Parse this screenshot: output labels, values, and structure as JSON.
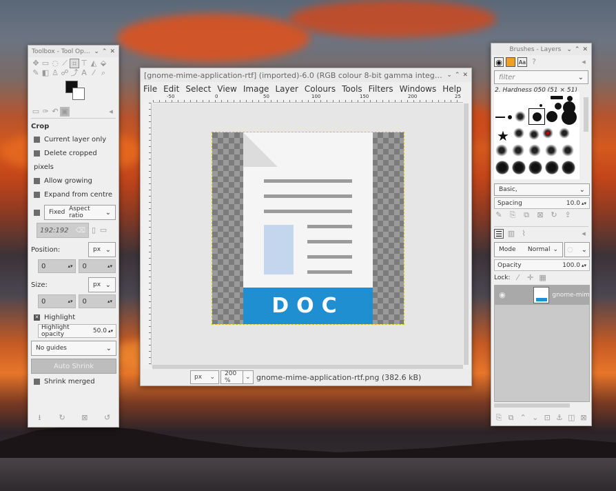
{
  "toolbox": {
    "title": "Toolbox - Tool Opti...",
    "tool_name": "Crop",
    "options": {
      "current_layer_only": "Current layer only",
      "delete_cropped_pixels": "Delete cropped pixels",
      "allow_growing": "Allow growing",
      "expand_from_centre": "Expand from centre",
      "fixed_label": "Fixed",
      "fixed_value": "Aspect ratio",
      "ratio_value": "192:192",
      "position_label": "Position:",
      "position_unit": "px",
      "position_x": "0",
      "position_y": "0",
      "size_label": "Size:",
      "size_unit": "px",
      "size_w": "0",
      "size_h": "0",
      "highlight": "Highlight",
      "highlight_opacity_label": "Highlight opacity",
      "highlight_opacity_value": "50.0",
      "guides": "No guides",
      "auto_shrink": "Auto Shrink",
      "shrink_merged": "Shrink merged"
    }
  },
  "image_window": {
    "title": "[gnome-mime-application-rtf] (imported)-6.0 (RGB colour 8-bit gamma integer, GIM...",
    "menu": [
      "File",
      "Edit",
      "Select",
      "View",
      "Image",
      "Layer",
      "Colours",
      "Tools",
      "Filters",
      "Windows",
      "Help"
    ],
    "ruler_labels": [
      "-50",
      "0",
      "50",
      "100",
      "150",
      "200",
      "25"
    ],
    "doc_text": "DOC",
    "status": {
      "unit": "px",
      "zoom": "200 %",
      "filename": "gnome-mime-application-rtf.png (382.6 kB)"
    }
  },
  "brushes_layers": {
    "title": "Brushes - Layers",
    "filter_placeholder": "filter",
    "brush_name": "2. Hardness 050 (51 × 51)",
    "brush_set": "Basic,",
    "spacing_label": "Spacing",
    "spacing_value": "10.0",
    "mode_label": "Mode",
    "mode_value": "Normal",
    "opacity_label": "Opacity",
    "opacity_value": "100.0",
    "lock_label": "Lock:",
    "layer_name": "gnome-mim"
  }
}
